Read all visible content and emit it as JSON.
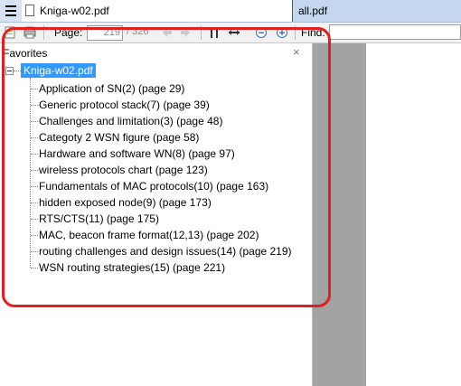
{
  "tabs": [
    {
      "label": "Kniga-w02.pdf",
      "active": true
    },
    {
      "label": "all.pdf",
      "active": false
    }
  ],
  "tab_close_glyph": "×",
  "toolbar": {
    "page_label": "Page:",
    "page_value": "219",
    "page_total": "/ 326",
    "find_label": "Find:",
    "icons": [
      "open-icon",
      "print-icon",
      "back-arrow-icon",
      "forward-arrow-icon",
      "fit-page-icon",
      "fit-width-icon",
      "zoom-out-icon",
      "zoom-in-icon"
    ]
  },
  "favorites": {
    "title": "Favorites",
    "close_glyph": "×",
    "root": "Kniga-w02.pdf",
    "items": [
      "Application of SN(2) (page 29)",
      "Generic protocol stack(7) (page 39)",
      "Challenges and limitation(3) (page 48)",
      "Categoty 2 WSN figure (page 58)",
      "Hardware and software WN(8) (page 97)",
      "wireless protocols chart (page 123)",
      "Fundamentals of MAC protocols(10) (page 163)",
      "hidden exposed node(9) (page 173)",
      "RTS/CTS(11) (page 175)",
      "MAC, beacon frame format(12,13) (page 202)",
      "routing challenges and design issues(14) (page 219)",
      "WSN routing strategies(15) (page 221)"
    ]
  },
  "colors": {
    "selection": "#3399ff",
    "highlight_border": "#e02020",
    "doc_background": "#a3a3a3",
    "tab_strip": "#d6e3f2"
  }
}
